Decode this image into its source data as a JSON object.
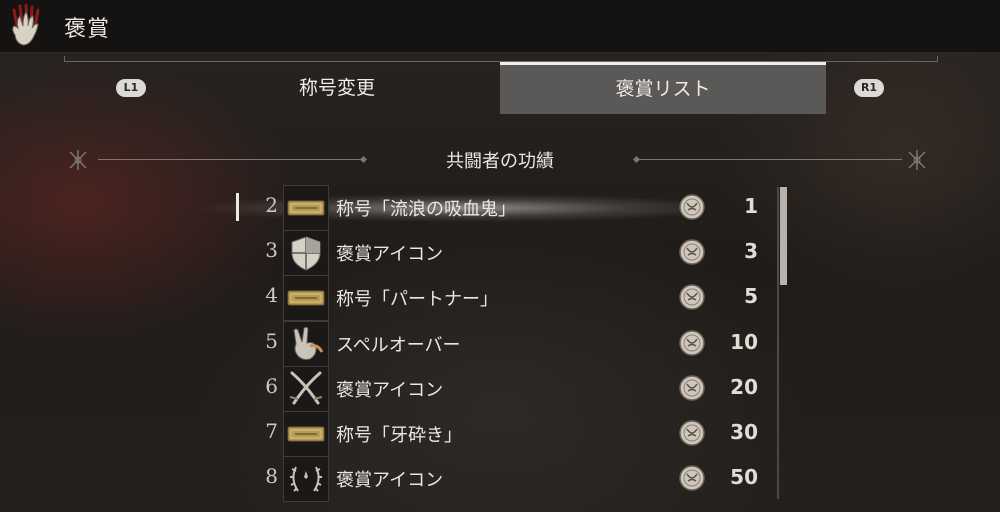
{
  "header": {
    "title": "褒賞"
  },
  "tabs": [
    {
      "label": "称号変更",
      "active": false
    },
    {
      "label": "褒賞リスト",
      "active": true
    }
  ],
  "button_hints": {
    "left": "L1",
    "right": "R1"
  },
  "section": {
    "title": "共闘者の功績"
  },
  "rewards": [
    {
      "index": "2",
      "name": "称号「流浪の吸血鬼」",
      "cost": "1",
      "icon": "title-plate-icon"
    },
    {
      "index": "3",
      "name": "褒賞アイコン",
      "cost": "3",
      "icon": "shield-icon"
    },
    {
      "index": "4",
      "name": "称号「パートナー」",
      "cost": "5",
      "icon": "title-plate-icon"
    },
    {
      "index": "5",
      "name": "スペルオーバー",
      "cost": "10",
      "icon": "victory-hand-icon"
    },
    {
      "index": "6",
      "name": "褒賞アイコン",
      "cost": "20",
      "icon": "crossed-blades-icon"
    },
    {
      "index": "7",
      "name": "称号「牙砕き」",
      "cost": "30",
      "icon": "title-plate-icon"
    },
    {
      "index": "8",
      "name": "褒賞アイコン",
      "cost": "50",
      "icon": "laurel-wreath-icon"
    }
  ],
  "selected_index": 0,
  "currency_icon": "medal-icon",
  "colors": {
    "active_tab_bg": "#5a5958",
    "active_tab_border": "#efefef",
    "topbar_bg": "#141312"
  }
}
